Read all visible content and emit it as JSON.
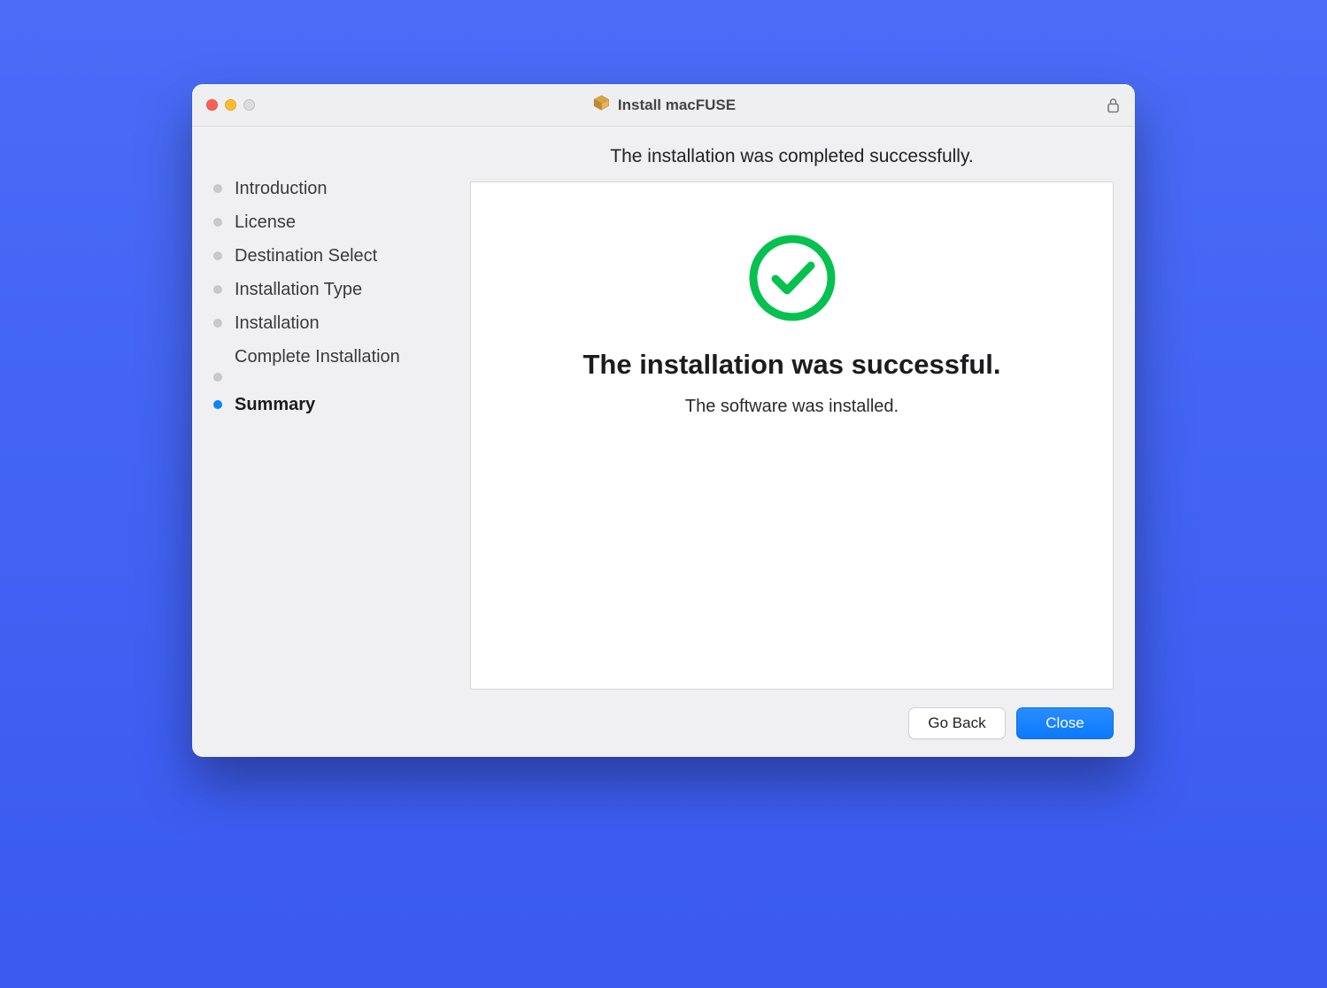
{
  "window": {
    "title": "Install macFUSE"
  },
  "subtitle": "The installation was completed successfully.",
  "sidebar": {
    "steps": [
      {
        "label": "Introduction",
        "active": false
      },
      {
        "label": "License",
        "active": false
      },
      {
        "label": "Destination Select",
        "active": false
      },
      {
        "label": "Installation Type",
        "active": false
      },
      {
        "label": "Installation",
        "active": false
      },
      {
        "label": "Complete Installation",
        "active": false
      },
      {
        "label": "Summary",
        "active": true
      }
    ]
  },
  "main": {
    "heading": "The installation was successful.",
    "subtext": "The software was installed."
  },
  "footer": {
    "go_back": "Go Back",
    "close": "Close"
  }
}
